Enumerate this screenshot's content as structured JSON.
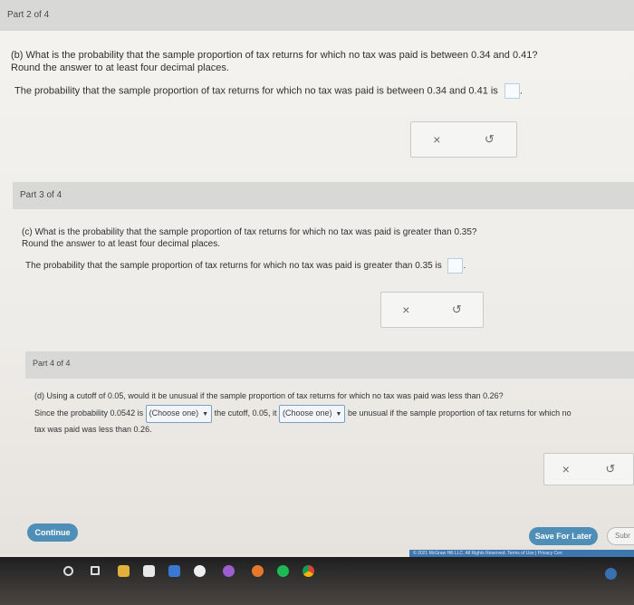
{
  "part2": {
    "header": "Part 2 of 4",
    "question_line1": "(b) What is the probability that the sample proportion of tax returns for which no tax was paid is between 0.34 and 0.41?",
    "question_line2": "Round the answer to at least four decimal places.",
    "answer_text": "The probability that the sample proportion of tax returns for which no tax was paid is between 0.34 and 0.41 is",
    "answer_value": "",
    "clear_label": "×",
    "undo_label": "↺"
  },
  "part3": {
    "header": "Part 3 of 4",
    "question_line1": "(c) What is the probability that the sample proportion of tax returns for which no tax was paid is greater than 0.35?",
    "question_line2": "Round the answer to at least four decimal places.",
    "answer_text": "The probability that the sample proportion of tax returns for which no tax was paid is greater than 0.35 is",
    "answer_value": "",
    "clear_label": "×",
    "undo_label": "↺"
  },
  "part4": {
    "header": "Part 4 of 4",
    "question_line1": "(d) Using a cutoff of 0.05, would it be unusual if the sample proportion of tax returns for which no tax was paid was less than 0.26?",
    "since_text": "Since the probability 0.0542 is",
    "select1": "(Choose one)",
    "mid_text": "the cutoff, 0.05, it",
    "select2": "(Choose one)",
    "end_text": "be unusual if the sample proportion of tax returns for which no",
    "line3": "tax was paid was less than 0.26.",
    "clear_label": "×",
    "undo_label": "↺"
  },
  "footer": {
    "continue_label": "Continue",
    "save_label": "Save For Later",
    "submit_label": "Subr",
    "copyright": "© 2021 McGraw Hill LLC. All Rights Reserved.   Terms of Use  |  Privacy Cen"
  },
  "taskbar": {
    "icons": [
      "search-icon",
      "task-view-icon",
      "file-explorer-icon",
      "store-icon",
      "mail-icon",
      "edge-icon",
      "chrome-icon",
      "firefox-icon",
      "spotify-icon",
      "edge-blue-icon",
      "chrome-icon-2"
    ]
  }
}
